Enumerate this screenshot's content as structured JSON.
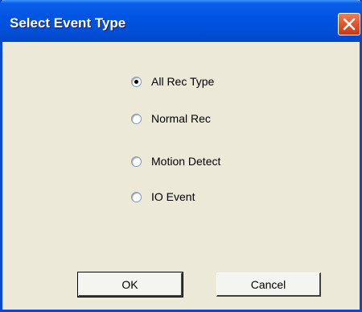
{
  "window": {
    "title": "Select Event Type"
  },
  "options": [
    {
      "label": "All Rec Type",
      "checked": true
    },
    {
      "label": "Normal Rec",
      "checked": false
    },
    {
      "label": "Motion Detect",
      "checked": false
    },
    {
      "label": "IO Event",
      "checked": false
    }
  ],
  "buttons": {
    "ok_label": "OK",
    "cancel_label": "Cancel"
  },
  "icons": {
    "close": "close-icon"
  },
  "colors": {
    "titlebar": "#0054E3",
    "background": "#ECE9D8",
    "close_button": "#E0552E"
  }
}
